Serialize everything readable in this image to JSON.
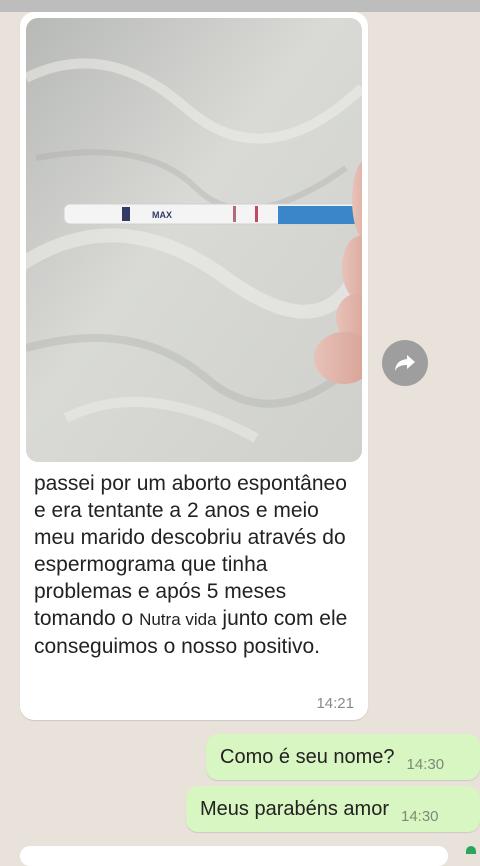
{
  "incoming_message": {
    "text_before": "passei por um aborto espontâneo e era tentante a 2 anos e meio meu marido descobriu através do espermograma  que tinha problemas e  após 5 meses tomando o ",
    "product_name": "Nutra vida",
    "text_after": " junto com ele conseguimos o nosso positivo.",
    "time": "14:21",
    "photo_test_label": "MAX"
  },
  "outgoing_messages": [
    {
      "text": "Como é seu nome?",
      "time": "14:30"
    },
    {
      "text": "Meus parabéns amor",
      "time": "14:30"
    }
  ],
  "icons": {
    "forward": "forward-arrow-icon"
  },
  "colors": {
    "chat_background": "#e8e2da",
    "incoming_bubble": "#ffffff",
    "outgoing_bubble": "#d8f6c2"
  }
}
